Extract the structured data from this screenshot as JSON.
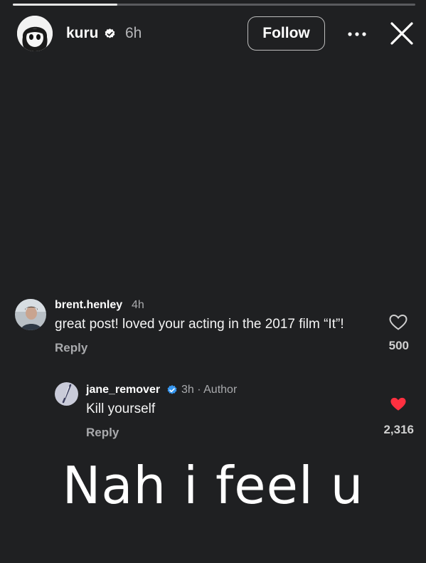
{
  "story": {
    "progress_fraction": 0.26
  },
  "header": {
    "username": "kuru",
    "time": "6h",
    "follow_label": "Follow",
    "icons": [
      "verified-badge-icon",
      "more-options-icon",
      "close-icon"
    ]
  },
  "comments": [
    {
      "username": "brent.henley",
      "time": "4h",
      "text": "great post! loved your acting in the 2017 film “It”!",
      "reply_label": "Reply",
      "like_count": "500",
      "liked": false
    },
    {
      "username": "jane_remover",
      "time": "3h · Author",
      "text": "Kill yourself",
      "reply_label": "Reply",
      "like_count": "2,316",
      "liked": true
    }
  ],
  "caption": "Nah i feel u",
  "colors": {
    "background": "#1f2022",
    "verified_blue": "#3797f0",
    "heart_red": "#ff3040"
  }
}
